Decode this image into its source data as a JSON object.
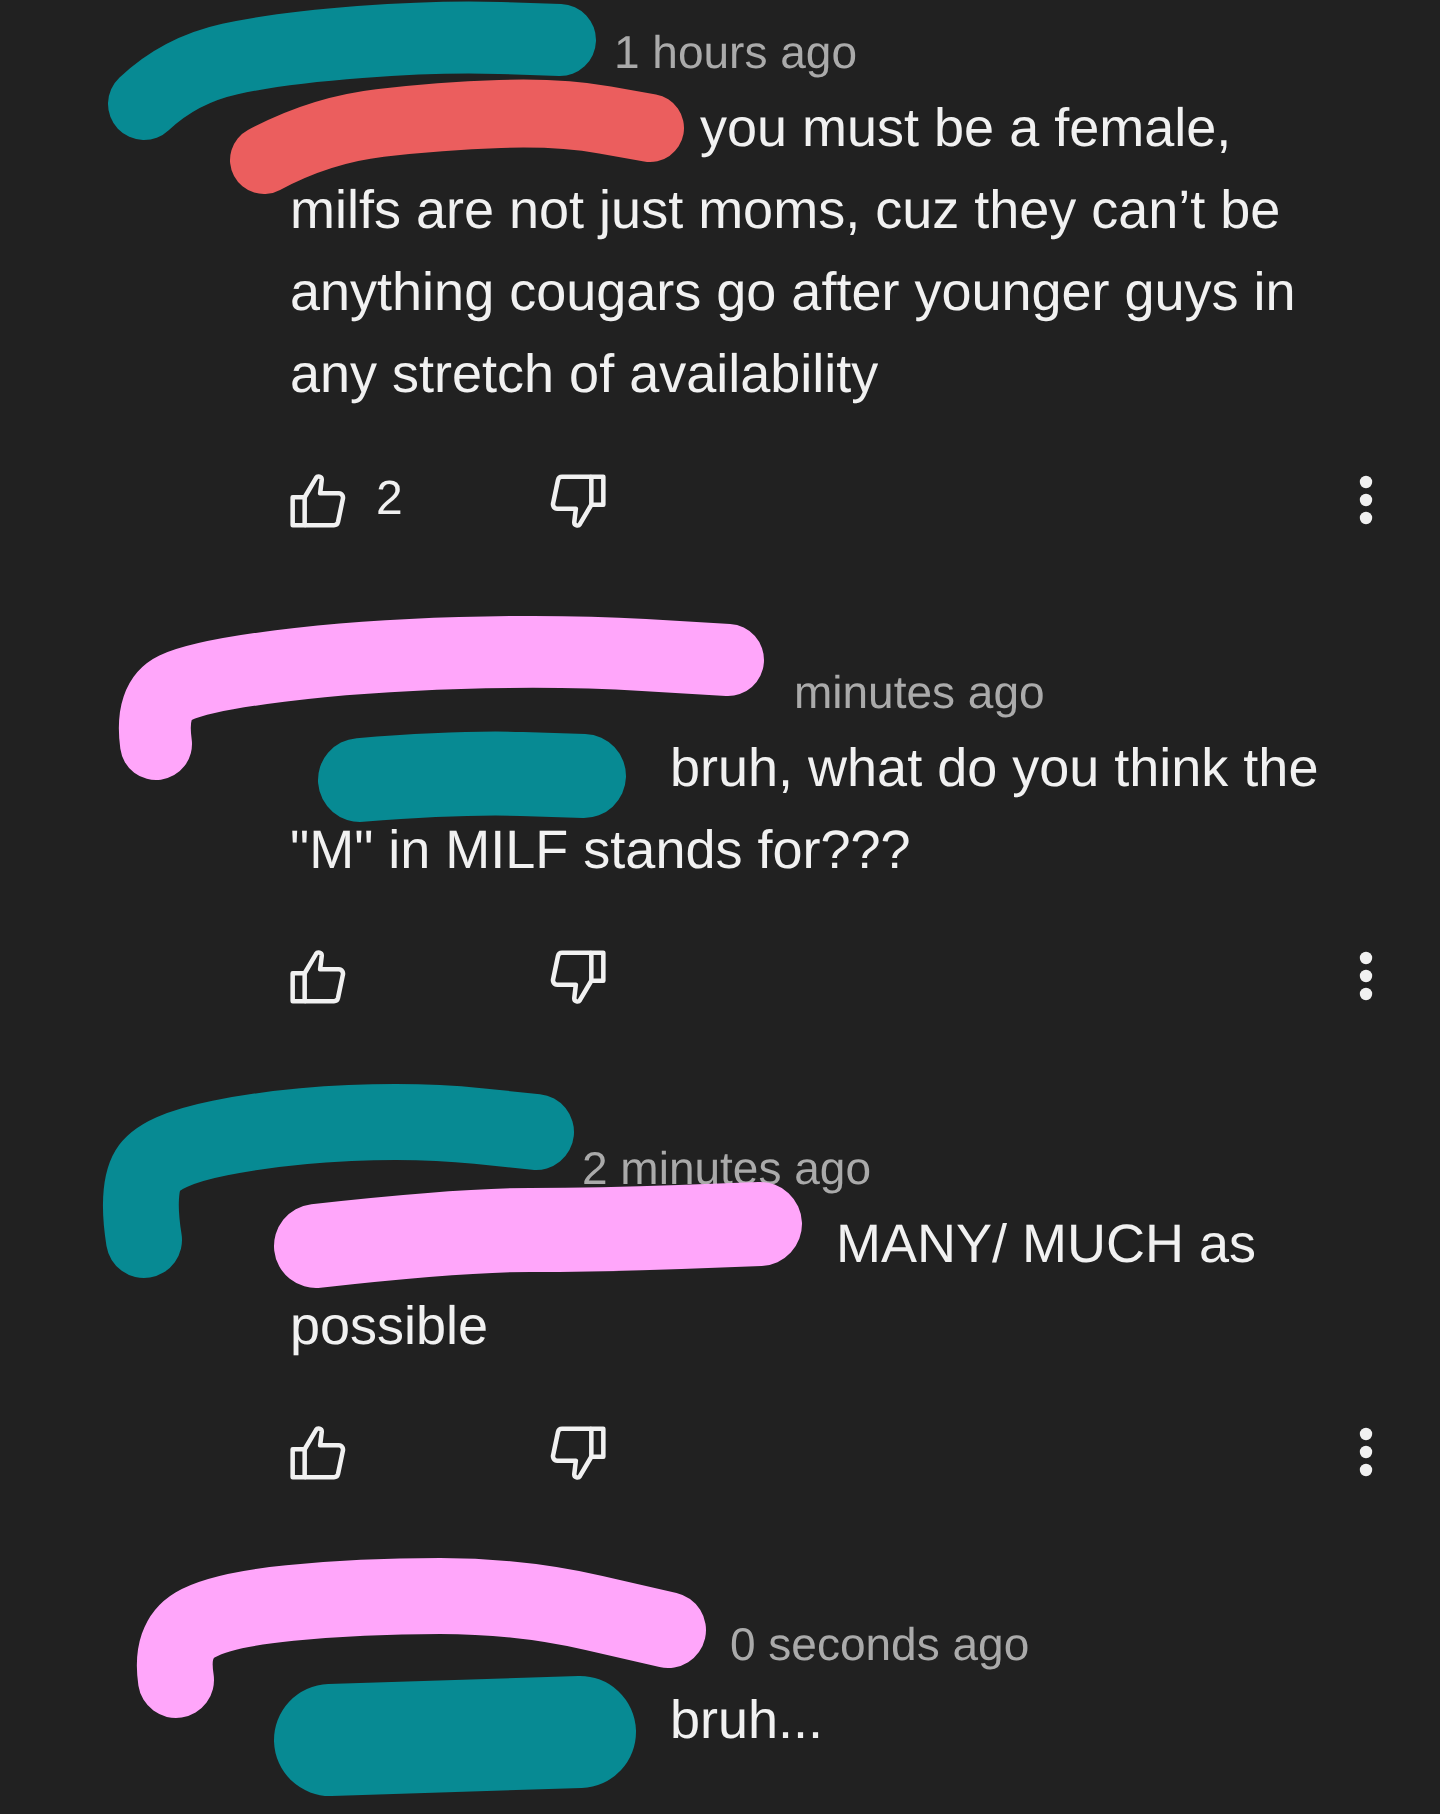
{
  "comments": [
    {
      "redactions": [
        {
          "color": "#078a93"
        },
        {
          "color": "#eb5e5e"
        }
      ],
      "time": "1 hours ago",
      "text": "you must be a female, milfs are not just moms, cuz they can’t be anything cougars go after younger guys in any stretch of availability",
      "likes": "2",
      "action_bar": true
    },
    {
      "redactions": [
        {
          "color": "#ffa6fa"
        },
        {
          "color": "#078a93"
        }
      ],
      "time": "minutes ago",
      "text": "bruh, what do you think the \"M\" in MILF stands for???",
      "action_bar": true
    },
    {
      "redactions": [
        {
          "color": "#078a93"
        },
        {
          "color": "#ffa6fa"
        }
      ],
      "time": "2 minutes ago",
      "text": "MANY/ MUCH as possible",
      "action_bar": true
    },
    {
      "redactions": [
        {
          "color": "#ffa6fa"
        },
        {
          "color": "#078a93"
        }
      ],
      "time": "0 seconds ago",
      "text": "bruh...",
      "action_bar": false
    }
  ]
}
